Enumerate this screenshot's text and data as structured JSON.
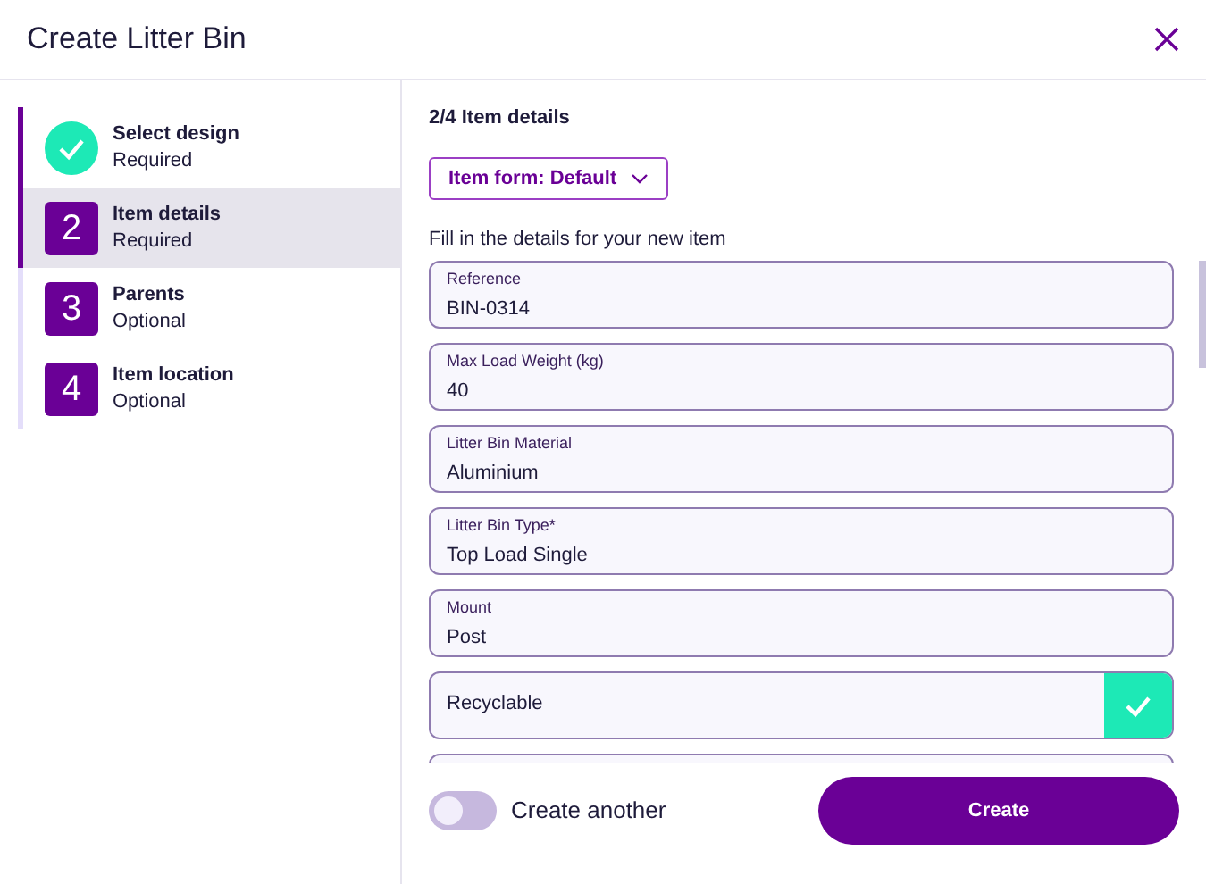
{
  "window": {
    "title": "Create Litter Bin"
  },
  "steps": [
    {
      "title": "Select design",
      "subtitle": "Required",
      "done": true,
      "selected": false
    },
    {
      "number": "2",
      "title": "Item details",
      "subtitle": "Required",
      "done": false,
      "selected": true
    },
    {
      "number": "3",
      "title": "Parents",
      "subtitle": "Optional",
      "done": false,
      "selected": false
    },
    {
      "number": "4",
      "title": "Item location",
      "subtitle": "Optional",
      "done": false,
      "selected": false
    }
  ],
  "content": {
    "heading": "2/4 Item details",
    "form_button": "Item form: Default",
    "instruction": "Fill in the details for your new item",
    "fields": [
      {
        "kind": "text",
        "label": "Reference",
        "value": "BIN-0314"
      },
      {
        "kind": "text",
        "label": "Max Load Weight (kg)",
        "value": "40"
      },
      {
        "kind": "text",
        "label": "Litter Bin Material",
        "value": "Aluminium"
      },
      {
        "kind": "text",
        "label": "Litter Bin Type*",
        "value": "Top Load Single"
      },
      {
        "kind": "text",
        "label": "Mount",
        "value": "Post"
      },
      {
        "kind": "checkbox",
        "label": "Recyclable",
        "checked": true
      }
    ]
  },
  "footer": {
    "toggle": {
      "label": "Create another",
      "on": false
    },
    "create_button": "Create"
  }
}
